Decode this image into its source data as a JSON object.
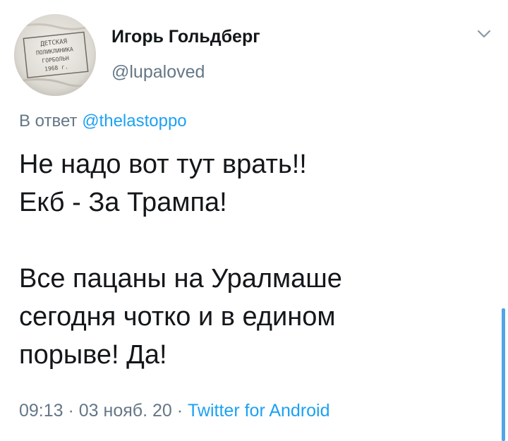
{
  "author": {
    "name": "Игорь Гольдберг",
    "handle": "@lupaloved",
    "avatar_icon": "stamp-photo-avatar",
    "avatar_stamp_lines": [
      "ДЕТСКАЯ",
      "ПОЛИКЛИНИКА",
      "ГОРБОЛЬН",
      "1968 г."
    ]
  },
  "reply": {
    "prefix": "В ответ",
    "mention": "@thelastoppo"
  },
  "tweet": {
    "lines": [
      "Не надо вот тут врать!!",
      "Екб - За Трампа!",
      "",
      "Все пацаны на Уралмаше",
      "сегодня чотко и в едином",
      "порыве! Да!"
    ]
  },
  "meta": {
    "time": "09:13",
    "separator": " · ",
    "date": "03 нояб. 20",
    "source": "Twitter for Android"
  },
  "colors": {
    "text": "#14171a",
    "secondary": "#657786",
    "link": "#1da1f2",
    "scroll_accent": "#50a5e6"
  },
  "icons": {
    "caret": "chevron-down-icon"
  }
}
